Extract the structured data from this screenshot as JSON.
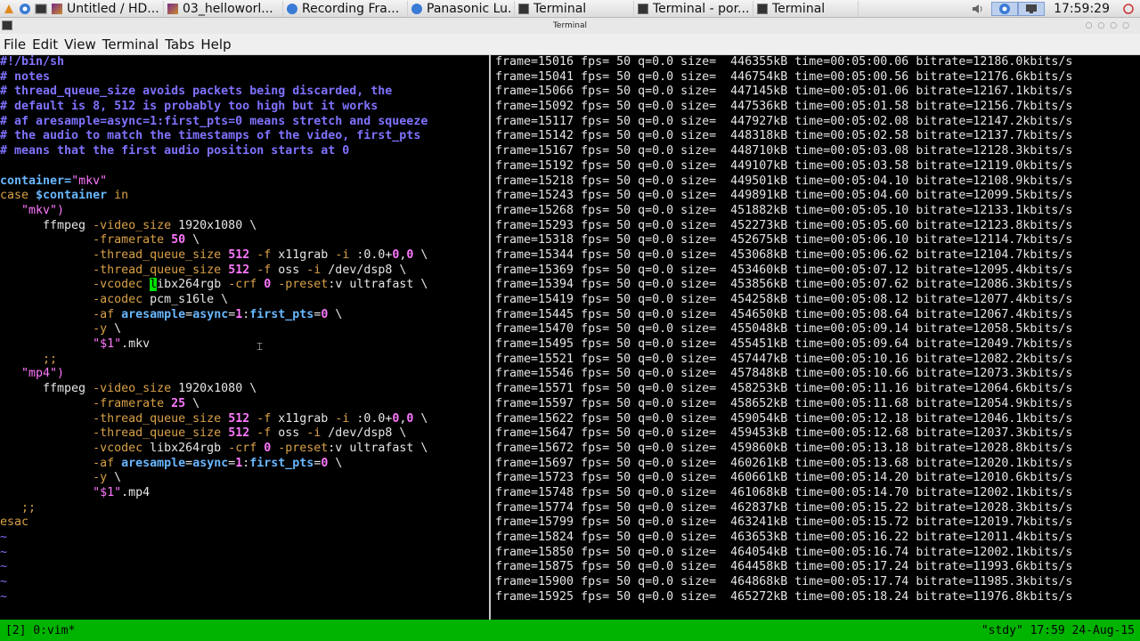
{
  "taskbar": {
    "tasks": [
      {
        "label": "Untitled / HD...",
        "icon": "feather-icon"
      },
      {
        "label": "03_helloworl...",
        "icon": "feather-icon"
      },
      {
        "label": "Recording Fra...",
        "icon": "chromium-icon"
      },
      {
        "label": "Panasonic Lu...",
        "icon": "chromium-icon"
      },
      {
        "label": "Terminal",
        "icon": "terminal-icon"
      },
      {
        "label": "Terminal - por...",
        "icon": "terminal-icon"
      },
      {
        "label": "Terminal",
        "icon": "terminal-icon"
      }
    ],
    "clock": "17:59:29"
  },
  "window": {
    "title": "Terminal"
  },
  "menu": [
    "File",
    "Edit",
    "View",
    "Terminal",
    "Tabs",
    "Help"
  ],
  "vim": {
    "lines": [
      [
        {
          "t": "#!/bin/sh",
          "c": "cmt"
        }
      ],
      [
        {
          "t": "# notes",
          "c": "cmt"
        }
      ],
      [
        {
          "t": "# thread_queue_size avoids packets being discarded, the",
          "c": "cmt"
        }
      ],
      [
        {
          "t": "# default is 8, 512 is probably too high but it works",
          "c": "cmt"
        }
      ],
      [
        {
          "t": "# af aresample=async=1:first_pts=0 means stretch and squeeze",
          "c": "cmt"
        }
      ],
      [
        {
          "t": "# the audio to match the timestamps of the video, first_pts",
          "c": "cmt"
        }
      ],
      [
        {
          "t": "# means that the first audio position starts at 0",
          "c": "cmt"
        }
      ],
      [],
      [
        {
          "t": "container=",
          "c": "var"
        },
        {
          "t": "\"mkv\"",
          "c": "str"
        }
      ],
      [
        {
          "t": "case ",
          "c": "kw"
        },
        {
          "t": "$container",
          "c": "var"
        },
        {
          "t": " in",
          "c": "kw"
        }
      ],
      [
        {
          "t": "   \"mkv\")",
          "c": "str"
        }
      ],
      [
        {
          "t": "      ffmpeg ",
          "c": "txt"
        },
        {
          "t": "-video_size",
          "c": "flg"
        },
        {
          "t": " 1920x1080 \\",
          "c": "txt"
        }
      ],
      [
        {
          "t": "             ",
          "c": "txt"
        },
        {
          "t": "-framerate",
          "c": "flg"
        },
        {
          "t": " 50",
          "c": "num"
        },
        {
          "t": " \\",
          "c": "txt"
        }
      ],
      [
        {
          "t": "             ",
          "c": "txt"
        },
        {
          "t": "-thread_queue_size",
          "c": "flg"
        },
        {
          "t": " 512",
          "c": "num"
        },
        {
          "t": " -f",
          "c": "flg"
        },
        {
          "t": " x11grab ",
          "c": "txt"
        },
        {
          "t": "-i",
          "c": "flg"
        },
        {
          "t": " :0.0+",
          "c": "txt"
        },
        {
          "t": "0",
          "c": "num"
        },
        {
          "t": ",",
          "c": "txt"
        },
        {
          "t": "0",
          "c": "num"
        },
        {
          "t": " \\",
          "c": "txt"
        }
      ],
      [
        {
          "t": "             ",
          "c": "txt"
        },
        {
          "t": "-thread_queue_size",
          "c": "flg"
        },
        {
          "t": " 512",
          "c": "num"
        },
        {
          "t": " -f",
          "c": "flg"
        },
        {
          "t": " oss ",
          "c": "txt"
        },
        {
          "t": "-i",
          "c": "flg"
        },
        {
          "t": " /dev/dsp8 \\",
          "c": "txt"
        }
      ],
      [
        {
          "t": "             ",
          "c": "txt"
        },
        {
          "t": "-vcodec",
          "c": "flg"
        },
        {
          "t": " ",
          "c": "txt"
        },
        {
          "t": "l",
          "c": "cursor"
        },
        {
          "t": "ibx264rgb ",
          "c": "txt"
        },
        {
          "t": "-crf",
          "c": "flg"
        },
        {
          "t": " 0",
          "c": "num"
        },
        {
          "t": " -preset",
          "c": "flg"
        },
        {
          "t": ":v ultrafast \\",
          "c": "txt"
        }
      ],
      [
        {
          "t": "             ",
          "c": "txt"
        },
        {
          "t": "-acodec",
          "c": "flg"
        },
        {
          "t": " pcm_s16le \\",
          "c": "txt"
        }
      ],
      [
        {
          "t": "             ",
          "c": "txt"
        },
        {
          "t": "-af",
          "c": "flg"
        },
        {
          "t": " aresample",
          "c": "var"
        },
        {
          "t": "=",
          "c": "txt"
        },
        {
          "t": "async",
          "c": "var"
        },
        {
          "t": "=",
          "c": "txt"
        },
        {
          "t": "1",
          "c": "num"
        },
        {
          "t": ":",
          "c": "txt"
        },
        {
          "t": "first_pts",
          "c": "var"
        },
        {
          "t": "=",
          "c": "txt"
        },
        {
          "t": "0",
          "c": "num"
        },
        {
          "t": " \\",
          "c": "txt"
        }
      ],
      [
        {
          "t": "             ",
          "c": "txt"
        },
        {
          "t": "-y",
          "c": "flg"
        },
        {
          "t": " \\",
          "c": "txt"
        }
      ],
      [
        {
          "t": "             ",
          "c": "txt"
        },
        {
          "t": "\"$1\"",
          "c": "str"
        },
        {
          "t": ".mkv",
          "c": "txt"
        }
      ],
      [
        {
          "t": "      ;;",
          "c": "kw"
        }
      ],
      [
        {
          "t": "   \"mp4\")",
          "c": "str"
        }
      ],
      [
        {
          "t": "      ffmpeg ",
          "c": "txt"
        },
        {
          "t": "-video_size",
          "c": "flg"
        },
        {
          "t": " 1920x1080 \\",
          "c": "txt"
        }
      ],
      [
        {
          "t": "             ",
          "c": "txt"
        },
        {
          "t": "-framerate",
          "c": "flg"
        },
        {
          "t": " 25",
          "c": "num"
        },
        {
          "t": " \\",
          "c": "txt"
        }
      ],
      [
        {
          "t": "             ",
          "c": "txt"
        },
        {
          "t": "-thread_queue_size",
          "c": "flg"
        },
        {
          "t": " 512",
          "c": "num"
        },
        {
          "t": " -f",
          "c": "flg"
        },
        {
          "t": " x11grab ",
          "c": "txt"
        },
        {
          "t": "-i",
          "c": "flg"
        },
        {
          "t": " :0.0+",
          "c": "txt"
        },
        {
          "t": "0",
          "c": "num"
        },
        {
          "t": ",",
          "c": "txt"
        },
        {
          "t": "0",
          "c": "num"
        },
        {
          "t": " \\",
          "c": "txt"
        }
      ],
      [
        {
          "t": "             ",
          "c": "txt"
        },
        {
          "t": "-thread_queue_size",
          "c": "flg"
        },
        {
          "t": " 512",
          "c": "num"
        },
        {
          "t": " -f",
          "c": "flg"
        },
        {
          "t": " oss ",
          "c": "txt"
        },
        {
          "t": "-i",
          "c": "flg"
        },
        {
          "t": " /dev/dsp8 \\",
          "c": "txt"
        }
      ],
      [
        {
          "t": "             ",
          "c": "txt"
        },
        {
          "t": "-vcodec",
          "c": "flg"
        },
        {
          "t": " libx264rgb ",
          "c": "txt"
        },
        {
          "t": "-crf",
          "c": "flg"
        },
        {
          "t": " 0",
          "c": "num"
        },
        {
          "t": " -preset",
          "c": "flg"
        },
        {
          "t": ":v ultrafast \\",
          "c": "txt"
        }
      ],
      [
        {
          "t": "             ",
          "c": "txt"
        },
        {
          "t": "-af",
          "c": "flg"
        },
        {
          "t": " aresample",
          "c": "var"
        },
        {
          "t": "=",
          "c": "txt"
        },
        {
          "t": "async",
          "c": "var"
        },
        {
          "t": "=",
          "c": "txt"
        },
        {
          "t": "1",
          "c": "num"
        },
        {
          "t": ":",
          "c": "txt"
        },
        {
          "t": "first_pts",
          "c": "var"
        },
        {
          "t": "=",
          "c": "txt"
        },
        {
          "t": "0",
          "c": "num"
        },
        {
          "t": " \\",
          "c": "txt"
        }
      ],
      [
        {
          "t": "             ",
          "c": "txt"
        },
        {
          "t": "-y",
          "c": "flg"
        },
        {
          "t": " \\",
          "c": "txt"
        }
      ],
      [
        {
          "t": "             ",
          "c": "txt"
        },
        {
          "t": "\"$1\"",
          "c": "str"
        },
        {
          "t": ".mp4",
          "c": "txt"
        }
      ],
      [
        {
          "t": "   ;;",
          "c": "kw"
        }
      ],
      [
        {
          "t": "esac",
          "c": "kw"
        }
      ],
      [
        {
          "t": "~",
          "c": "tilde"
        }
      ],
      [
        {
          "t": "~",
          "c": "tilde"
        }
      ],
      [
        {
          "t": "~",
          "c": "tilde"
        }
      ],
      [
        {
          "t": "~",
          "c": "tilde"
        }
      ],
      [
        {
          "t": "~",
          "c": "tilde"
        }
      ]
    ]
  },
  "ffmpeg_log": [
    "frame=15016 fps= 50 q=0.0 size=  446355kB time=00:05:00.06 bitrate=12186.0kbits/s",
    "frame=15041 fps= 50 q=0.0 size=  446754kB time=00:05:00.56 bitrate=12176.6kbits/s",
    "frame=15066 fps= 50 q=0.0 size=  447145kB time=00:05:01.06 bitrate=12167.1kbits/s",
    "frame=15092 fps= 50 q=0.0 size=  447536kB time=00:05:01.58 bitrate=12156.7kbits/s",
    "frame=15117 fps= 50 q=0.0 size=  447927kB time=00:05:02.08 bitrate=12147.2kbits/s",
    "frame=15142 fps= 50 q=0.0 size=  448318kB time=00:05:02.58 bitrate=12137.7kbits/s",
    "frame=15167 fps= 50 q=0.0 size=  448710kB time=00:05:03.08 bitrate=12128.3kbits/s",
    "frame=15192 fps= 50 q=0.0 size=  449107kB time=00:05:03.58 bitrate=12119.0kbits/s",
    "frame=15218 fps= 50 q=0.0 size=  449501kB time=00:05:04.10 bitrate=12108.9kbits/s",
    "frame=15243 fps= 50 q=0.0 size=  449891kB time=00:05:04.60 bitrate=12099.5kbits/s",
    "frame=15268 fps= 50 q=0.0 size=  451882kB time=00:05:05.10 bitrate=12133.1kbits/s",
    "frame=15293 fps= 50 q=0.0 size=  452273kB time=00:05:05.60 bitrate=12123.8kbits/s",
    "frame=15318 fps= 50 q=0.0 size=  452675kB time=00:05:06.10 bitrate=12114.7kbits/s",
    "frame=15344 fps= 50 q=0.0 size=  453068kB time=00:05:06.62 bitrate=12104.7kbits/s",
    "frame=15369 fps= 50 q=0.0 size=  453460kB time=00:05:07.12 bitrate=12095.4kbits/s",
    "frame=15394 fps= 50 q=0.0 size=  453856kB time=00:05:07.62 bitrate=12086.3kbits/s",
    "frame=15419 fps= 50 q=0.0 size=  454258kB time=00:05:08.12 bitrate=12077.4kbits/s",
    "frame=15445 fps= 50 q=0.0 size=  454650kB time=00:05:08.64 bitrate=12067.4kbits/s",
    "frame=15470 fps= 50 q=0.0 size=  455048kB time=00:05:09.14 bitrate=12058.5kbits/s",
    "frame=15495 fps= 50 q=0.0 size=  455451kB time=00:05:09.64 bitrate=12049.7kbits/s",
    "frame=15521 fps= 50 q=0.0 size=  457447kB time=00:05:10.16 bitrate=12082.2kbits/s",
    "frame=15546 fps= 50 q=0.0 size=  457848kB time=00:05:10.66 bitrate=12073.3kbits/s",
    "frame=15571 fps= 50 q=0.0 size=  458253kB time=00:05:11.16 bitrate=12064.6kbits/s",
    "frame=15597 fps= 50 q=0.0 size=  458652kB time=00:05:11.68 bitrate=12054.9kbits/s",
    "frame=15622 fps= 50 q=0.0 size=  459054kB time=00:05:12.18 bitrate=12046.1kbits/s",
    "frame=15647 fps= 50 q=0.0 size=  459453kB time=00:05:12.68 bitrate=12037.3kbits/s",
    "frame=15672 fps= 50 q=0.0 size=  459860kB time=00:05:13.18 bitrate=12028.8kbits/s",
    "frame=15697 fps= 50 q=0.0 size=  460261kB time=00:05:13.68 bitrate=12020.1kbits/s",
    "frame=15723 fps= 50 q=0.0 size=  460661kB time=00:05:14.20 bitrate=12010.6kbits/s",
    "frame=15748 fps= 50 q=0.0 size=  461068kB time=00:05:14.70 bitrate=12002.1kbits/s",
    "frame=15774 fps= 50 q=0.0 size=  462837kB time=00:05:15.22 bitrate=12028.3kbits/s",
    "frame=15799 fps= 50 q=0.0 size=  463241kB time=00:05:15.72 bitrate=12019.7kbits/s",
    "frame=15824 fps= 50 q=0.0 size=  463653kB time=00:05:16.22 bitrate=12011.4kbits/s",
    "frame=15850 fps= 50 q=0.0 size=  464054kB time=00:05:16.74 bitrate=12002.1kbits/s",
    "frame=15875 fps= 50 q=0.0 size=  464458kB time=00:05:17.24 bitrate=11993.6kbits/s",
    "frame=15900 fps= 50 q=0.0 size=  464868kB time=00:05:17.74 bitrate=11985.3kbits/s",
    "frame=15925 fps= 50 q=0.0 size=  465272kB time=00:05:18.24 bitrate=11976.8kbits/s"
  ],
  "status": {
    "left": "[2] 0:vim*",
    "right": "\"stdy\" 17:59 24-Aug-15"
  },
  "colors": {
    "status_bar": "#00b300",
    "comment": "#7f72ff",
    "keyword": "#d8a047",
    "string": "#ff78ff",
    "cursor": "#00e000"
  }
}
